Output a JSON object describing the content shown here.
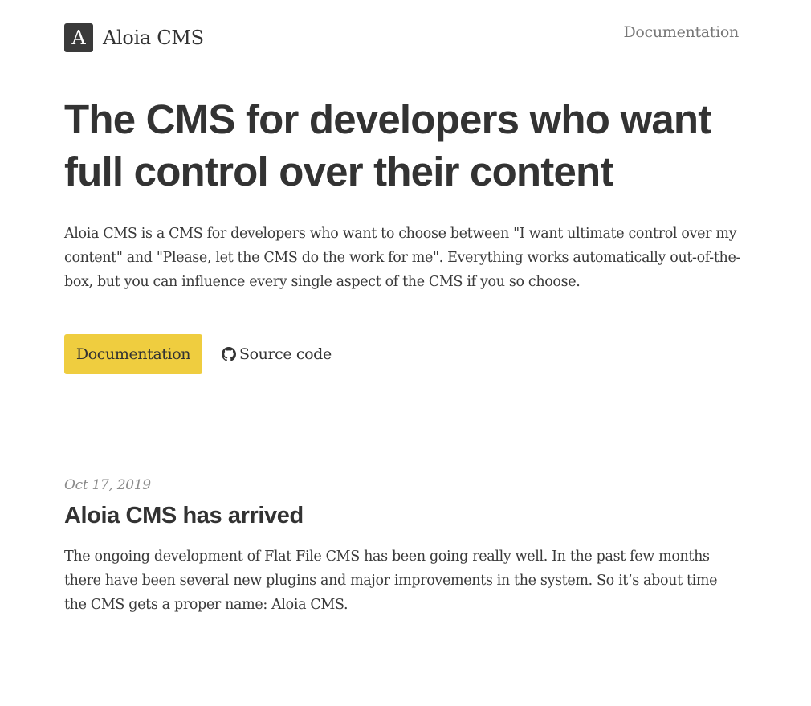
{
  "header": {
    "logo_letter": "A",
    "site_name": "Aloia CMS",
    "nav_documentation": "Documentation"
  },
  "hero": {
    "title": "The CMS for developers who want full control over their content",
    "description": "Aloia CMS is a CMS for developers who want to choose between \"I want ultimate control over my content\" and \"Please, let the CMS do the work for me\". Everything works automatically out-of-the-box, but you can influence every single aspect of the CMS if you so choose.",
    "primary_button": "Documentation",
    "source_link": "Source code",
    "source_icon": "github-icon"
  },
  "post": {
    "date": "Oct 17, 2019",
    "title": "Aloia CMS has arrived",
    "excerpt": "The ongoing development of Flat File CMS has been going really well. In the past few months there have been several new plugins and major improvements in the system. So it’s about time the CMS gets a proper name: Aloia CMS."
  },
  "colors": {
    "accent_button": "#efcd3f",
    "text": "#333333",
    "muted": "#777777",
    "logo_bg": "#3a3a3a"
  }
}
